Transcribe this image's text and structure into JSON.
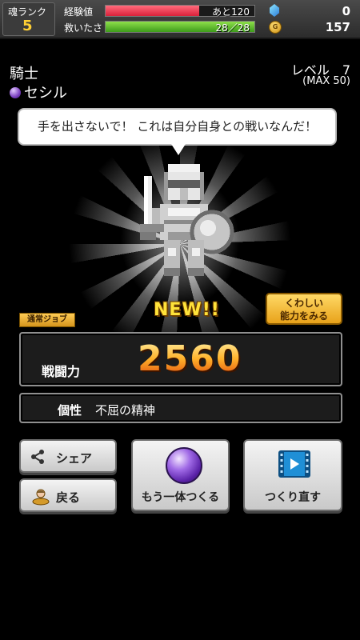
{
  "status": {
    "soul_rank_label": "魂ランク",
    "soul_rank_value": "5",
    "exp_label": "経験値",
    "exp_text": "あと120",
    "exp_fraction": 0.63,
    "rescue_label": "救いたさ",
    "rescue_text": "28／28",
    "rescue_fraction": 1.0,
    "gems": "0",
    "coins": "157",
    "coin_symbol": "G"
  },
  "character": {
    "job": "騎士",
    "name": "セシル",
    "level_text": "レベル　7",
    "level_max": "(MAX 50)",
    "quote": "手を出さないで！ これは自分自身との戦いなんだ！",
    "new_badge": "NEW!!",
    "job_type": "通常ジョブ"
  },
  "detail_button": {
    "line1": "くわしい",
    "line2": "能力をみる"
  },
  "stats": {
    "power_label": "戦闘力",
    "power_value": "2560",
    "trait_label": "個性",
    "trait_value": "不屈の精神"
  },
  "buttons": {
    "share": "シェア",
    "back": "戻る",
    "make_another": "もう一体つくる",
    "remake": "つくり直す"
  },
  "colors": {
    "exp_bar": "#d8213a",
    "hp_bar": "#3d9b1a",
    "accent_gold": "#ffb12a"
  },
  "icons": [
    "gem-icon",
    "coin-icon",
    "purple-orb-icon",
    "share-icon",
    "back-icon",
    "film-icon",
    "knight-sprite"
  ]
}
